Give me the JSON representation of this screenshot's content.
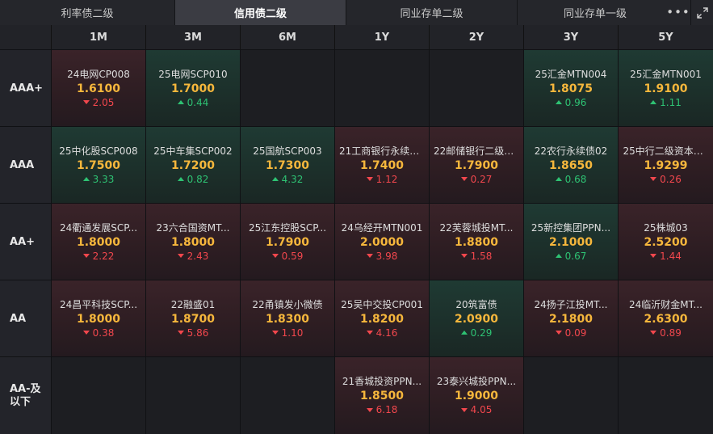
{
  "tabs": [
    {
      "label": "利率债二级"
    },
    {
      "label": "信用债二级"
    },
    {
      "label": "同业存单二级"
    },
    {
      "label": "同业存单一级"
    }
  ],
  "icons": {
    "more": "more-dots-icon",
    "expand": "expand-icon"
  },
  "colors": {
    "yield": "#f6b73c",
    "down": "#f2474d",
    "up": "#2ec273"
  },
  "columns": [
    "1M",
    "3M",
    "6M",
    "1Y",
    "2Y",
    "3Y",
    "5Y"
  ],
  "rows": [
    {
      "label": "AAA+",
      "cells": [
        {
          "name": "24电网CP008",
          "yield": "1.6100",
          "change": "2.05",
          "dir": "down"
        },
        {
          "name": "25电网SCP010",
          "yield": "1.7000",
          "change": "0.44",
          "dir": "up"
        },
        null,
        null,
        null,
        {
          "name": "25汇金MTN004",
          "yield": "1.8075",
          "change": "0.96",
          "dir": "up"
        },
        {
          "name": "25汇金MTN001",
          "yield": "1.9100",
          "change": "1.11",
          "dir": "up"
        }
      ]
    },
    {
      "label": "AAA",
      "cells": [
        {
          "name": "25中化股SCP008",
          "yield": "1.7500",
          "change": "3.33",
          "dir": "up"
        },
        {
          "name": "25中车集SCP002",
          "yield": "1.7200",
          "change": "0.82",
          "dir": "up"
        },
        {
          "name": "25国航SCP003",
          "yield": "1.7300",
          "change": "4.32",
          "dir": "up"
        },
        {
          "name": "21工商银行永续债...",
          "yield": "1.7400",
          "change": "1.12",
          "dir": "down"
        },
        {
          "name": "22邮储银行二级资本...",
          "yield": "1.7900",
          "change": "0.27",
          "dir": "down"
        },
        {
          "name": "22农行永续债02",
          "yield": "1.8650",
          "change": "0.68",
          "dir": "up"
        },
        {
          "name": "25中行二级资本债...",
          "yield": "1.9299",
          "change": "0.26",
          "dir": "down"
        }
      ]
    },
    {
      "label": "AA+",
      "cells": [
        {
          "name": "24衢通发展SCP...",
          "yield": "1.8000",
          "change": "2.22",
          "dir": "down"
        },
        {
          "name": "23六合国资MT...",
          "yield": "1.8000",
          "change": "2.43",
          "dir": "down"
        },
        {
          "name": "25江东控股SCP...",
          "yield": "1.7900",
          "change": "0.59",
          "dir": "down"
        },
        {
          "name": "24乌经开MTN001",
          "yield": "2.0000",
          "change": "3.98",
          "dir": "down"
        },
        {
          "name": "22芙蓉城投MT...",
          "yield": "1.8800",
          "change": "1.58",
          "dir": "down"
        },
        {
          "name": "25新控集团PPN...",
          "yield": "2.1000",
          "change": "0.67",
          "dir": "up"
        },
        {
          "name": "25株城03",
          "yield": "2.5200",
          "change": "1.44",
          "dir": "down"
        }
      ]
    },
    {
      "label": "AA",
      "cells": [
        {
          "name": "24昌平科技SCP...",
          "yield": "1.8000",
          "change": "0.38",
          "dir": "down"
        },
        {
          "name": "22融盛01",
          "yield": "1.8700",
          "change": "5.86",
          "dir": "down"
        },
        {
          "name": "22甬镇发小微债",
          "yield": "1.8300",
          "change": "1.10",
          "dir": "down"
        },
        {
          "name": "25吴中交投CP001",
          "yield": "1.8200",
          "change": "4.16",
          "dir": "down"
        },
        {
          "name": "20筑富债",
          "yield": "2.0900",
          "change": "0.29",
          "dir": "up"
        },
        {
          "name": "24扬子江投MT...",
          "yield": "2.1800",
          "change": "0.09",
          "dir": "down"
        },
        {
          "name": "24临沂财金MT...",
          "yield": "2.6300",
          "change": "0.89",
          "dir": "down"
        }
      ]
    },
    {
      "label": "AA-及以下",
      "label_lines": [
        "AA-及",
        "以下"
      ],
      "cells": [
        null,
        null,
        null,
        {
          "name": "21香城投资PPN...",
          "yield": "1.8500",
          "change": "6.18",
          "dir": "down"
        },
        {
          "name": "23泰兴城投PPN...",
          "yield": "1.9000",
          "change": "4.05",
          "dir": "down"
        },
        null,
        null
      ]
    }
  ]
}
